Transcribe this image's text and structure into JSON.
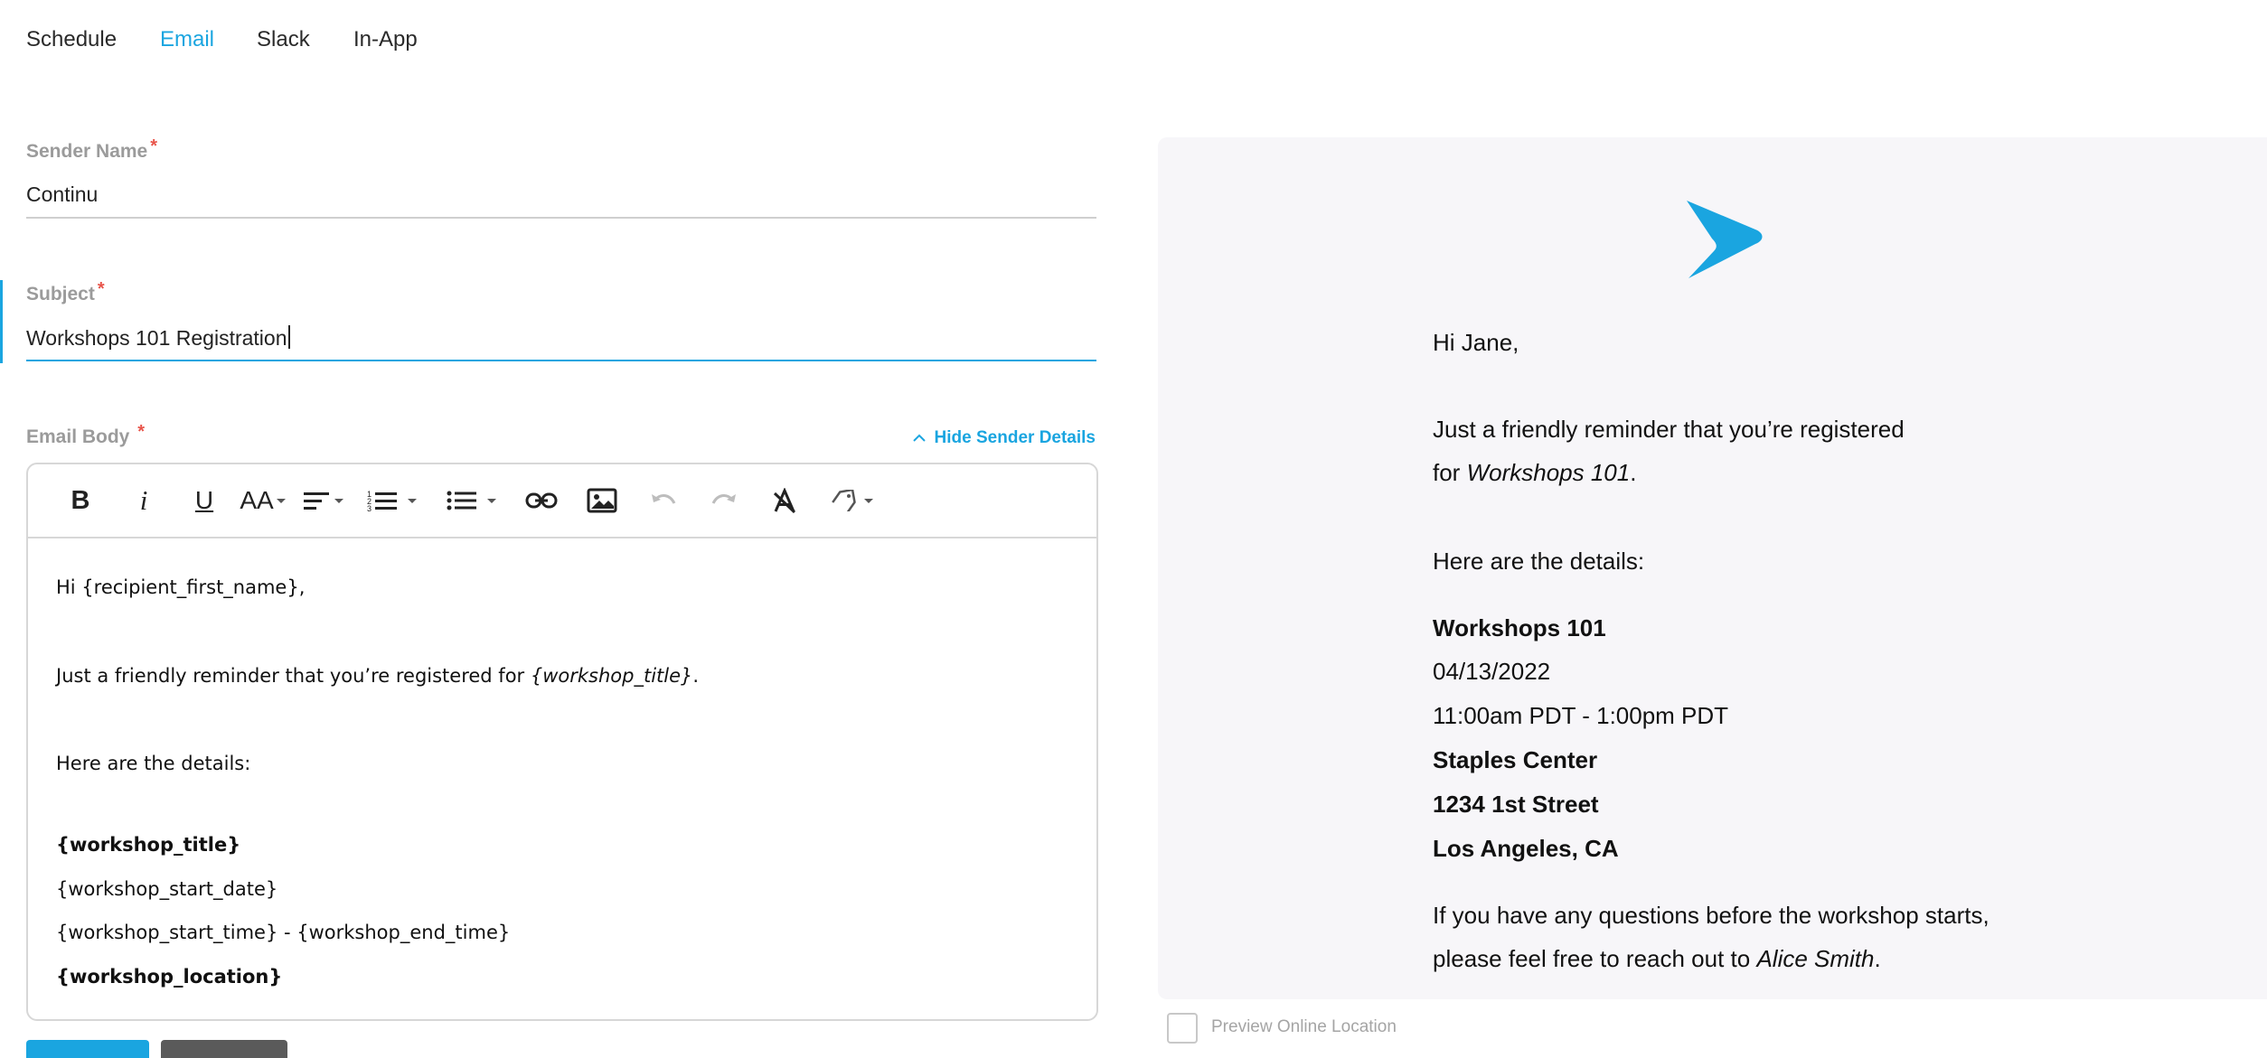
{
  "tabs": [
    "Schedule",
    "Email",
    "Slack",
    "In-App"
  ],
  "active_tab": "Email",
  "sender_name": {
    "label": "Sender Name",
    "required_mark": "*",
    "value": "Continu"
  },
  "subject": {
    "label": "Subject",
    "required_mark": "*",
    "value": "Workshops 101 Registration"
  },
  "email_body": {
    "label": "Email Body",
    "required_mark": "*",
    "hide_sender_label": "Hide Sender Details"
  },
  "toolbar": {
    "items": [
      "bold-icon",
      "italic-icon",
      "underline-icon",
      "font-size-icon",
      "align-icon",
      "ordered-list-icon",
      "unordered-list-icon",
      "link-icon",
      "image-icon",
      "undo-icon",
      "redo-icon",
      "clear-format-icon",
      "tag-icon"
    ],
    "bold_glyph": "B",
    "italic_glyph": "i",
    "underline_glyph": "U",
    "font_size_glyph": "AA"
  },
  "editor": {
    "greeting": "Hi {recipient_first_name},",
    "reminder_prefix": "Just a friendly reminder that you’re registered for ",
    "reminder_var": "{workshop_title}",
    "reminder_suffix": ".",
    "details_heading": "Here are the details:",
    "title_var": "{workshop_title}",
    "date_var": "{workshop_start_date}",
    "time_var": "{workshop_start_time} - {workshop_end_time}",
    "location_var": "{workshop_location}"
  },
  "preview": {
    "greeting": "Hi Jane,",
    "reminder_line1": "Just a friendly reminder that you’re registered",
    "reminder_line2_prefix": "for ",
    "reminder_title": "Workshops 101",
    "reminder_line2_suffix": ".",
    "details_heading": "Here are the details:",
    "title": "Workshops 101",
    "date": "04/13/2022",
    "time": "11:00am PDT - 1:00pm PDT",
    "location_name": "Staples Center",
    "location_street": "1234 1st Street",
    "location_city": "Los Angeles, CA",
    "questions_line1": "If you have any questions before the workshop starts,",
    "questions_line2_prefix": "please feel free to reach out to ",
    "questions_contact": "Alice Smith",
    "questions_line2_suffix": "."
  },
  "preview_online_location": {
    "label": "Preview Online Location",
    "checked": false
  },
  "colors": {
    "accent": "#1aa5e0",
    "required": "#e8544a",
    "preview_bg": "#f7f6f9"
  }
}
